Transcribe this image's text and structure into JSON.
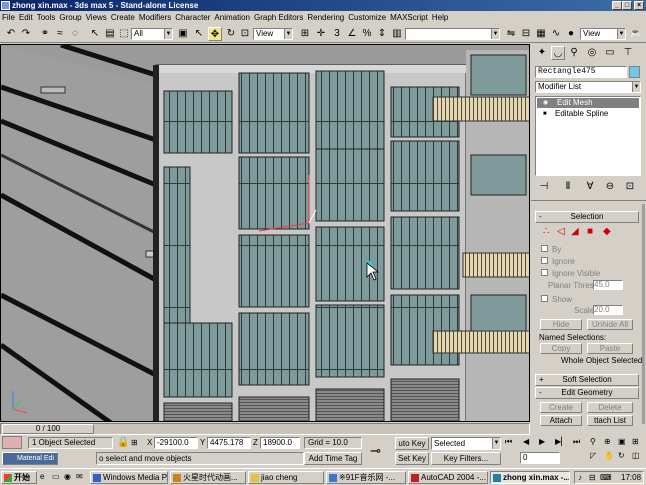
{
  "window": {
    "title": "zhong xin.max - 3ds max 5 - Stand-alone License",
    "min_label": "_",
    "max_label": "□",
    "close_label": "×"
  },
  "menu": [
    "File",
    "Edit",
    "Tools",
    "Group",
    "Views",
    "Create",
    "Modifiers",
    "Character",
    "Animation",
    "Graph Editors",
    "Rendering",
    "Customize",
    "MAXScript",
    "Help"
  ],
  "toolbar": {
    "selection_filter": "All",
    "ref_coord": "View",
    "named_selection": "",
    "view_right": "View",
    "undo_icon": "↶",
    "redo_icon": "↷",
    "select_icon": "↖",
    "move_icon": "✥",
    "rotate_icon": "↻",
    "scale_icon": "⊡",
    "render_icon": "☕"
  },
  "command_panel": {
    "object_name": "Rectangle475",
    "modifier_list": "Modifier List",
    "stack": [
      "Edit Mesh",
      "Editable Spline"
    ],
    "stack_icons": [
      "◉",
      "■"
    ],
    "selection_title": "Selection",
    "selection_minus": "-",
    "by_label": "By",
    "ignore_label": "Ignore",
    "ignore_visible_label": "Ignore Visible",
    "planar_thresh_label": "Planar Thresh",
    "planar_thresh_value": "45.0",
    "show_label": "Show",
    "scale_label": "Scale",
    "scale_value": "20.0",
    "hide_label": "Hide",
    "unhide_all_label": "Unhide All",
    "named_selections_label": "Named Selections:",
    "copy_label": "Copy",
    "paste_label": "Paste",
    "whole_object_label": "Whole Object Selected",
    "soft_selection_title": "Soft Selection",
    "soft_plus": "+",
    "edit_geometry_title": "Edit Geometry",
    "edit_minus": "-",
    "create_label": "Create",
    "delete_label": "Delete",
    "attach_label": "Attach",
    "attach_list_label": "ttach List"
  },
  "timeline": {
    "frame_label": "0 / 100"
  },
  "status": {
    "selected_text": "1 Object Selected",
    "prompt_text": "o select and move objects",
    "x_label": "X",
    "x_value": "-29100.0",
    "y_label": "Y",
    "y_value": "4475.178",
    "z_label": "Z",
    "z_value": "18900.0",
    "grid_text": "Grid = 10.0",
    "add_time_tag": "Add Time Tag",
    "auto_key": "uto Key",
    "set_key": "Set Key",
    "key_mode": "Selected",
    "key_filters": "Key Filters...",
    "frame_value": "0",
    "key_icon": "⊸",
    "viewport_axis_label": "Material Edi"
  },
  "taskbar": {
    "start": "开始",
    "tasks": [
      "Windows Media P...",
      "火星时代动画...",
      "jiao cheng",
      "※91F音乐网 -...",
      "AutoCAD 2004 -...",
      "zhong xin.max -..."
    ],
    "time": "17:08"
  }
}
